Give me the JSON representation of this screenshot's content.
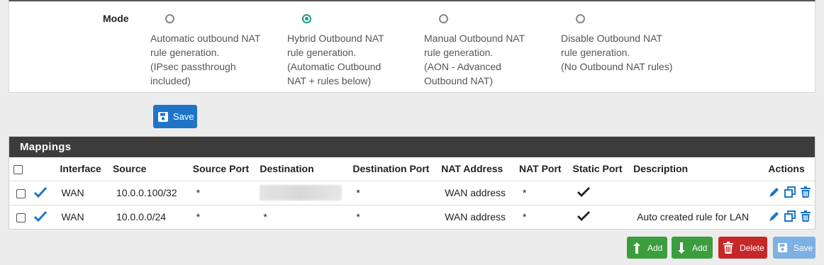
{
  "mode": {
    "label": "Mode",
    "options": [
      {
        "lines": [
          "Automatic outbound NAT",
          "rule generation.",
          "(IPsec passthrough",
          "included)"
        ],
        "checked": false
      },
      {
        "lines": [
          "Hybrid Outbound NAT",
          "rule generation.",
          "(Automatic Outbound",
          "NAT + rules below)"
        ],
        "checked": true
      },
      {
        "lines": [
          "Manual Outbound NAT",
          "rule generation.",
          "(AON - Advanced",
          "Outbound NAT)"
        ],
        "checked": false
      },
      {
        "lines": [
          "Disable Outbound NAT",
          "rule generation.",
          "(No Outbound NAT rules)"
        ],
        "checked": false
      }
    ],
    "save_label": "Save"
  },
  "mappings": {
    "title": "Mappings",
    "columns": [
      "Interface",
      "Source",
      "Source Port",
      "Destination",
      "Destination Port",
      "NAT Address",
      "NAT Port",
      "Static Port",
      "Description",
      "Actions"
    ],
    "rows": [
      {
        "interface": "WAN",
        "source": "10.0.0.100/32",
        "source_port": "*",
        "destination": "",
        "destination_redacted": true,
        "destination_port": "*",
        "nat_address": "WAN address",
        "nat_port": "*",
        "static_port": true,
        "description": ""
      },
      {
        "interface": "WAN",
        "source": "10.0.0.0/24",
        "source_port": "*",
        "destination": "*",
        "destination_redacted": false,
        "destination_port": "*",
        "nat_address": "WAN address",
        "nat_port": "*",
        "static_port": true,
        "description": "Auto created rule for LAN"
      }
    ]
  },
  "footer_buttons": {
    "add_top_label": "Add",
    "add_bottom_label": "Add",
    "delete_label": "Delete",
    "save_label": "Save"
  },
  "colors": {
    "primary": "#1e75c8",
    "success": "#3c9d3c",
    "danger": "#c62828",
    "accent_radio": "#1a9a8a",
    "header_bar": "#3c3c3c"
  }
}
